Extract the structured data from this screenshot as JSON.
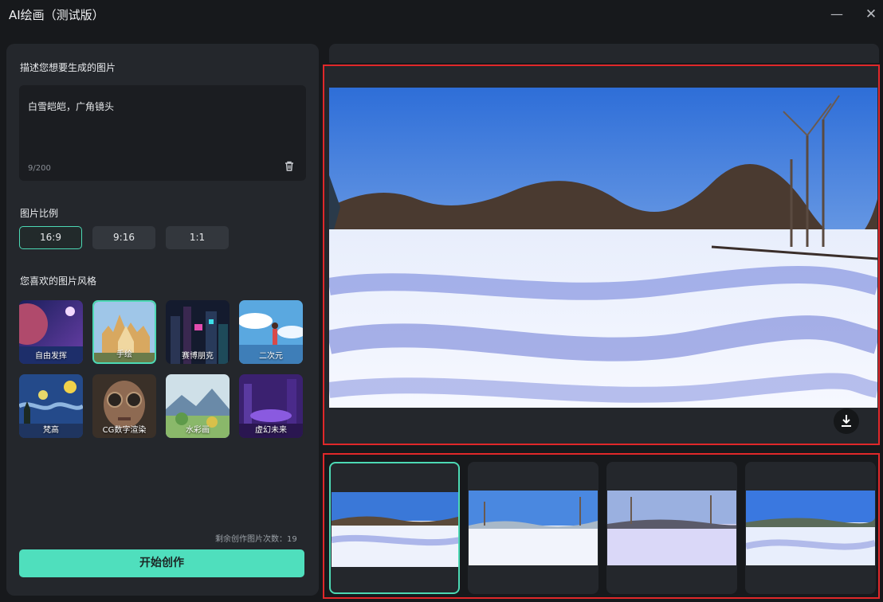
{
  "window": {
    "title": "AI绘画（测试版）",
    "minimize_glyph": "—",
    "close_glyph": "✕"
  },
  "prompt": {
    "section_label": "描述您想要生成的图片",
    "value": "白雪皑皑，广角镜头",
    "char_count": "9/200",
    "clear_icon": "trash-icon"
  },
  "ratio": {
    "section_label": "图片比例",
    "options": [
      "16:9",
      "9:16",
      "1:1"
    ],
    "selected": "16:9"
  },
  "style": {
    "section_label": "您喜欢的图片风格",
    "options": [
      "自由发挥",
      "手绘",
      "赛博朋克",
      "二次元",
      "梵高",
      "CG数字渲染",
      "水彩画",
      "虚幻未来"
    ],
    "selected": "手绘"
  },
  "remaining_label": "剩余创作图片次数：19",
  "start_button": "开始创作",
  "preview": {
    "download_icon": "download-icon"
  },
  "thumbnails": {
    "count": 4,
    "selected_index": 0
  },
  "colors": {
    "accent": "#4fdfbd",
    "highlight_frame": "#e0282a",
    "panel": "#24272c",
    "background": "#17191c"
  }
}
